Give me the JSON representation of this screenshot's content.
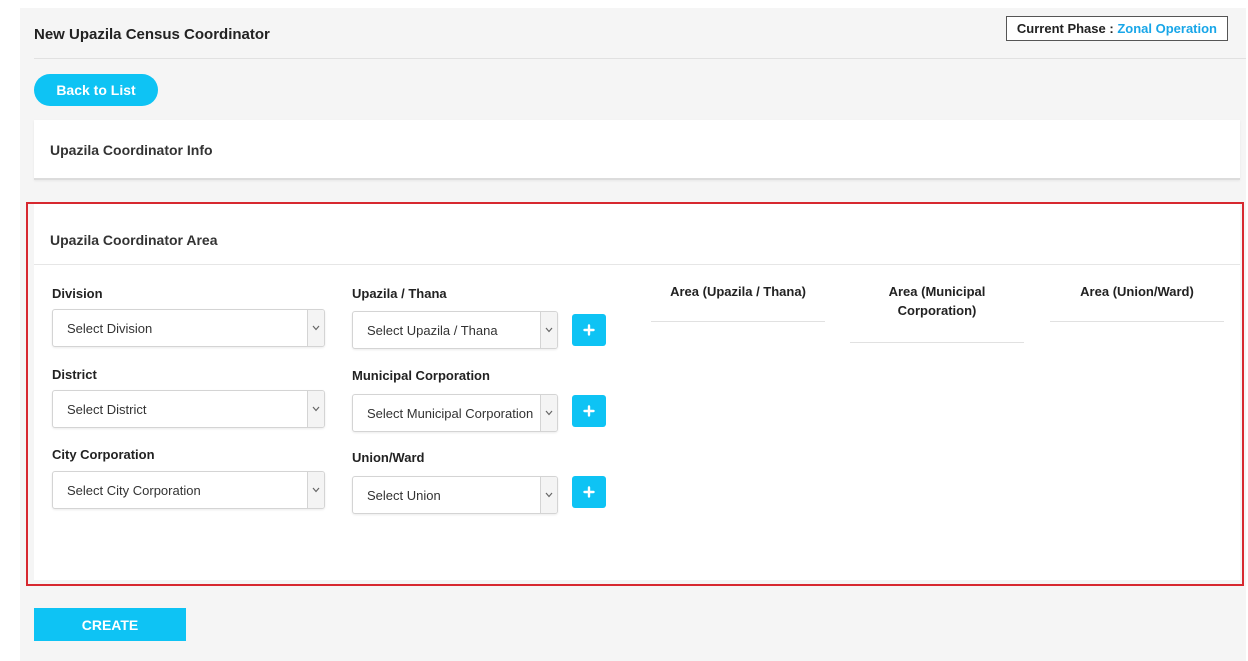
{
  "header": {
    "title": "New Upazila Census Coordinator",
    "phase_label": "Current Phase :",
    "phase_value": "Zonal Operation"
  },
  "back_button": "Back to List",
  "info_section": {
    "title": "Upazila Coordinator Info"
  },
  "area_section": {
    "title": "Upazila Coordinator Area",
    "fields": {
      "division": {
        "label": "Division",
        "value": "Select Division"
      },
      "district": {
        "label": "District",
        "value": "Select District"
      },
      "city_corporation": {
        "label": "City Corporation",
        "value": "Select City Corporation"
      },
      "upazila": {
        "label": "Upazila / Thana",
        "value": "Select Upazila / Thana"
      },
      "municipal": {
        "label": "Municipal Corporation",
        "value": "Select Municipal Corporation"
      },
      "union": {
        "label": "Union/Ward",
        "value": "Select Union"
      }
    },
    "columns": {
      "upazila": "Area (Upazila / Thana)",
      "municipal": "Area (Municipal Corporation)",
      "union": "Area (Union/Ward)"
    }
  },
  "create_button": "CREATE",
  "icons": {
    "dropdown": "chevron-down-icon",
    "add": "plus-icon"
  },
  "colors": {
    "accent": "#0ec3f4",
    "phase": "#18a6e8",
    "highlight": "#d7282f"
  }
}
